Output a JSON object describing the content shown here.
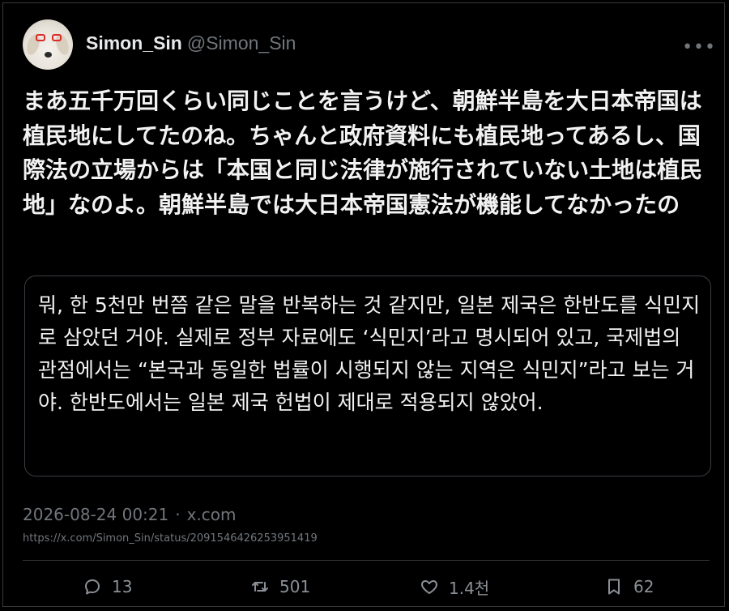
{
  "user": {
    "display_name": "Simon_Sin",
    "handle": "@Simon_Sin"
  },
  "more_icon": "more-horizontal-icon",
  "tweet": {
    "text": "まあ五千万回くらい同じことを言うけど、朝鮮半島を大日本帝国は植民地にしてたのね。ちゃんと政府資料にも植民地ってあるし、国際法の立場からは「本国と同じ法律が施行されていない土地は植民地」なのよ。朝鮮半島では大日本帝国憲法が機能してなかったの"
  },
  "translation": {
    "text": "뭐, 한 5천만 번쯤 같은 말을 반복하는 것 같지만, 일본 제국은 한반도를 식민지로 삼았던 거야. 실제로 정부 자료에도 ‘식민지’라고 명시되어 있고, 국제법의 관점에서는 “본국과 동일한 법률이 시행되지 않는 지역은 식민지”라고 보는 거야. 한반도에서는 일본 제국 헌법이 제대로 적용되지 않았어."
  },
  "meta": {
    "timestamp": "2026-08-24 00:21",
    "separator": "·",
    "source": "x.com",
    "url": "https://x.com/Simon_Sin/status/2091546426253951419"
  },
  "actions": {
    "reply_count": "13",
    "retweet_count": "501",
    "like_count": "1.4천",
    "bookmark_count": "62"
  },
  "colors": {
    "background": "#000000",
    "text": "#e7e9ea",
    "muted": "#71767b",
    "border": "#2f3336"
  }
}
